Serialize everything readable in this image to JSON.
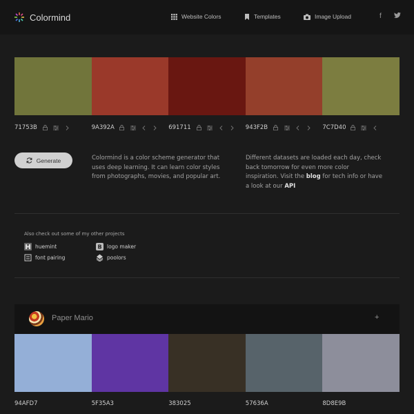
{
  "nav": {
    "brand": "Colormind",
    "links": [
      {
        "label": "Website Colors",
        "icon": "grid-icon"
      },
      {
        "label": "Templates",
        "icon": "bookmark-icon"
      },
      {
        "label": "Image Upload",
        "icon": "camera-icon"
      }
    ],
    "social": [
      {
        "label": "f",
        "icon": "facebook-icon"
      },
      {
        "label": "🐦",
        "icon": "twitter-icon"
      }
    ]
  },
  "palette": [
    {
      "hex": "71753B",
      "color": "#71753B"
    },
    {
      "hex": "9A392A",
      "color": "#9A392A"
    },
    {
      "hex": "691711",
      "color": "#691711"
    },
    {
      "hex": "943F2B",
      "color": "#943F2B"
    },
    {
      "hex": "7C7D40",
      "color": "#7C7D40"
    }
  ],
  "generate_label": "Generate",
  "desc1": "Colormind is a color scheme generator that uses deep learning. It can learn color styles from photographs, movies, and popular art.",
  "desc2": {
    "part1": "Different datasets are loaded each day, check back tomorrow for even more color inspiration. Visit the ",
    "link1": "blog",
    "part2": " for tech info or have a look at our ",
    "link2": "API"
  },
  "projects": {
    "title": "Also check out some of my other projects",
    "items": [
      {
        "label": "huemint",
        "icon": "huemint-icon"
      },
      {
        "label": "logo maker",
        "icon": "logo-maker-icon"
      },
      {
        "label": "font pairing",
        "icon": "font-pairing-icon"
      },
      {
        "label": "poolors",
        "icon": "poolors-icon"
      }
    ]
  },
  "card": {
    "title": "Paper Mario",
    "plus": "+",
    "palette": [
      {
        "hex": "94AFD7",
        "color": "#94AFD7"
      },
      {
        "hex": "5F35A3",
        "color": "#5F35A3"
      },
      {
        "hex": "383025",
        "color": "#383025"
      },
      {
        "hex": "57636A",
        "color": "#57636A"
      },
      {
        "hex": "8D8E9B",
        "color": "#8D8E9B"
      }
    ]
  }
}
